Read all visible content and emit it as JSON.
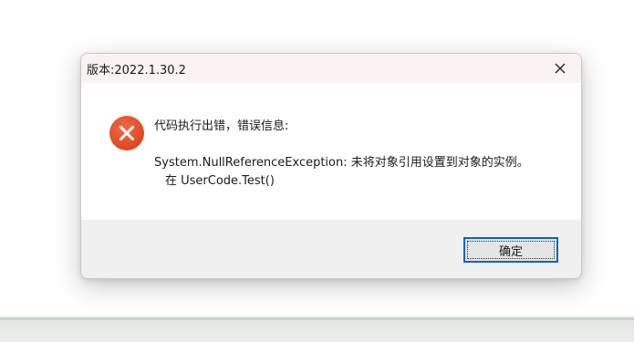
{
  "dialog": {
    "title": "版本:2022.1.30.2",
    "message_header": "代码执行出错，错误信息:",
    "exception_message": "System.NullReferenceException: 未将对象引用设置到对象的实例。",
    "stack_trace": "在 UserCode.Test()",
    "ok_label": "确定",
    "icons": {
      "error": "error-x-icon",
      "close": "close-icon"
    },
    "colors": {
      "error_icon": "#e5502c",
      "accent_border": "#0067c0",
      "titlebar_bg": "#fbf3f2",
      "footer_bg": "#f0f0f0"
    }
  }
}
